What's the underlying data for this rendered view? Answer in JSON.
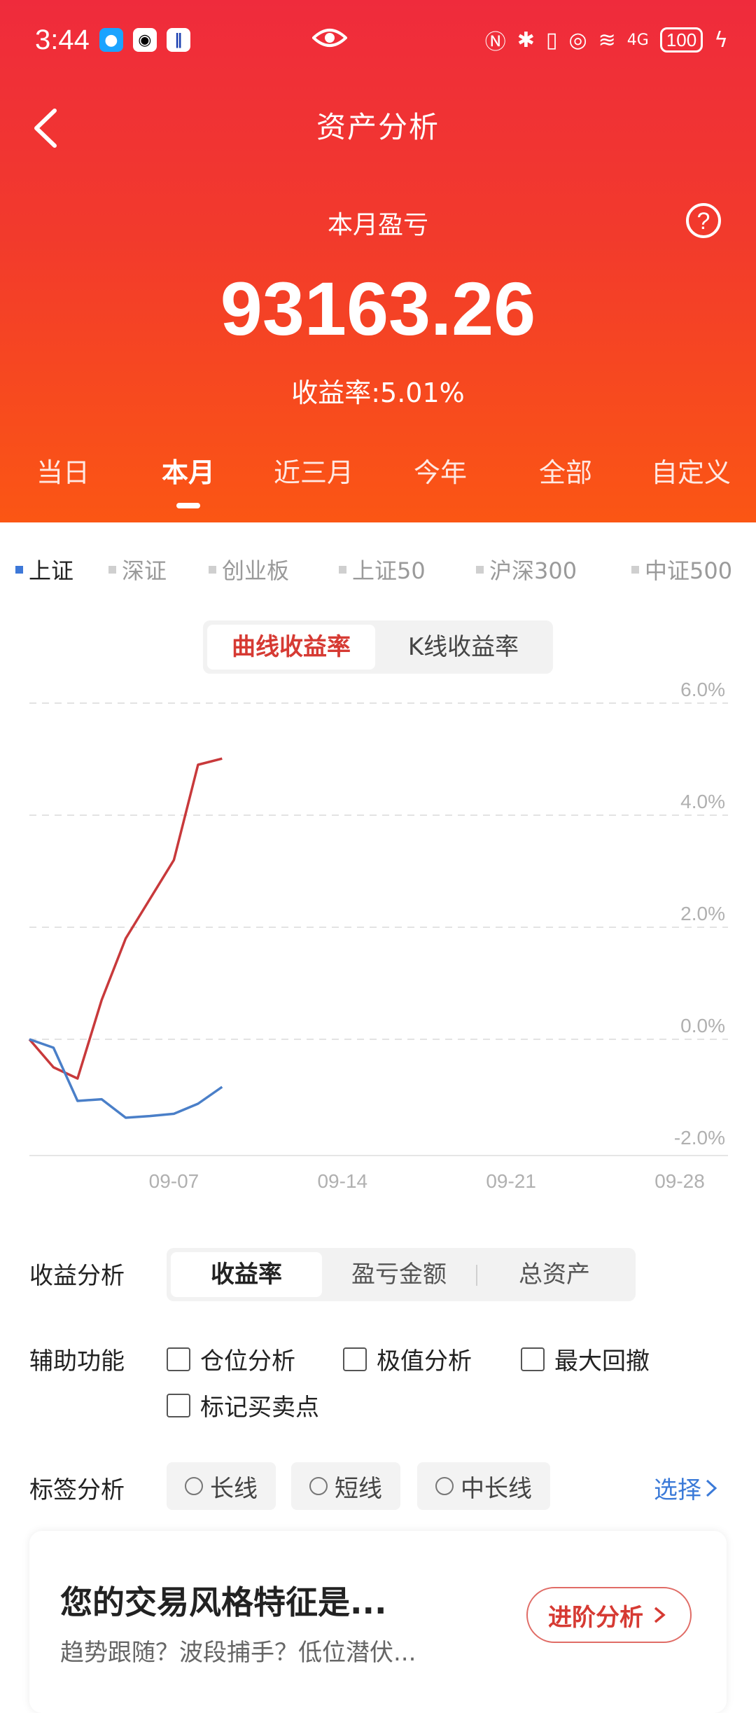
{
  "status_bar": {
    "time": "3:44",
    "battery": "100",
    "network": "4G"
  },
  "header": {
    "title": "资产分析"
  },
  "summary": {
    "label": "本月盈亏",
    "value": "93163.26",
    "rate": "收益率:5.01%"
  },
  "period_tabs": [
    "当日",
    "本月",
    "近三月",
    "今年",
    "全部",
    "自定义"
  ],
  "period_active": 1,
  "indexes": [
    "上证",
    "深证",
    "创业板",
    "上证50",
    "沪深300",
    "中证500"
  ],
  "index_active": 0,
  "chart_toggle": {
    "active": "曲线收益率",
    "inactive": "K线收益率"
  },
  "colors": {
    "hero_top": "#ef2b3c",
    "hero_bottom": "#fb5614",
    "portfolio_line": "#c8393b",
    "index_line": "#4a7fc8",
    "accent_blue": "#3b7ad8"
  },
  "chart_data": {
    "type": "line",
    "x_ticks": [
      "09-07",
      "09-14",
      "09-21",
      "09-28"
    ],
    "y_ticks": [
      "6.0%",
      "4.0%",
      "2.0%",
      "0.0%",
      "-2.0%"
    ],
    "ylim": [
      -2.0,
      6.0
    ],
    "grid": "dashed-horizontal",
    "series": [
      {
        "role": "portfolio",
        "x": [
          "09-01",
          "09-02",
          "09-03",
          "09-04",
          "09-05",
          "09-06",
          "09-07",
          "09-08",
          "09-09"
        ],
        "values": [
          0.0,
          -0.5,
          -0.7,
          0.7,
          1.8,
          2.5,
          3.2,
          4.9,
          5.01
        ]
      },
      {
        "role": "index",
        "x": [
          "09-01",
          "09-02",
          "09-03",
          "09-04",
          "09-05",
          "09-06",
          "09-07",
          "09-08",
          "09-09"
        ],
        "values": [
          0.0,
          -0.15,
          -1.1,
          -1.07,
          -1.4,
          -1.37,
          -1.33,
          -1.15,
          -0.85
        ]
      }
    ]
  },
  "analysis": {
    "label": "收益分析",
    "options": [
      "收益率",
      "盈亏金额",
      "总资产"
    ],
    "active": 0
  },
  "aux": {
    "label": "辅助功能",
    "options": [
      "仓位分析",
      "极值分析",
      "最大回撤",
      "标记买卖点"
    ]
  },
  "tags": {
    "label": "标签分析",
    "options": [
      "长线",
      "短线",
      "中长线"
    ],
    "select": "选择"
  },
  "promo": {
    "title": "您的交易风格特征是...",
    "subtitle": "趋势跟随？波段捕手？低位潜伏...",
    "button": "进阶分析"
  }
}
